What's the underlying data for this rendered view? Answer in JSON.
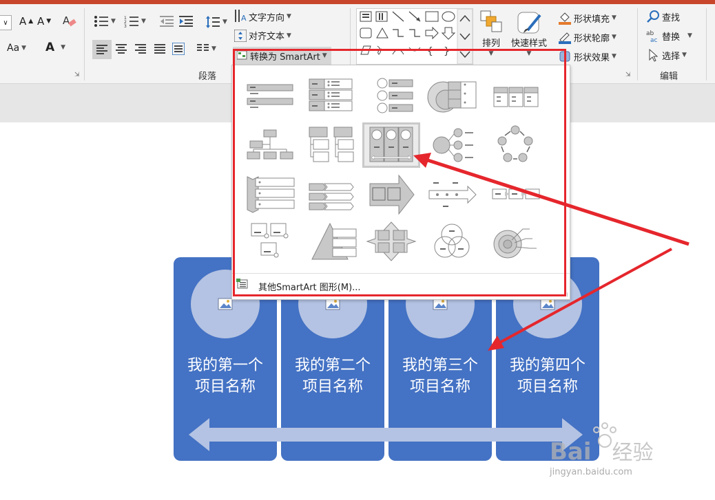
{
  "ribbon": {
    "font": {
      "grow_icon": "font-grow-icon",
      "shrink_icon": "font-shrink-icon",
      "clear_icon": "clear-format-icon",
      "case_label": "Aa",
      "color_label": "A"
    },
    "paragraph": {
      "text_direction": "文字方向",
      "align_text": "对齐文本",
      "convert_smartart": "转换为 SmartArt",
      "group_label": "段落"
    },
    "drawing": {
      "arrange": "排列",
      "quick_styles": "快速样式",
      "shape_fill": "形状填充",
      "shape_outline": "形状轮廓",
      "shape_effects": "形状效果"
    },
    "editing": {
      "find": "查找",
      "replace": "替换",
      "select": "选择",
      "group_label": "编辑"
    }
  },
  "dropdown": {
    "footer": "其他SmartArt 图形(M)...",
    "items": [
      {
        "name": "vertical-bullet-list"
      },
      {
        "name": "vertical-box-list"
      },
      {
        "name": "vertical-circle-list"
      },
      {
        "name": "nested-target-list"
      },
      {
        "name": "horizontal-bullet-list"
      },
      {
        "name": "hierarchy"
      },
      {
        "name": "hierarchy-list"
      },
      {
        "name": "picture-accent-process"
      },
      {
        "name": "radial-list"
      },
      {
        "name": "basic-cycle"
      },
      {
        "name": "chevron-list"
      },
      {
        "name": "arrow-list"
      },
      {
        "name": "up-arrow-process"
      },
      {
        "name": "timeline-arrow"
      },
      {
        "name": "process-arrows"
      },
      {
        "name": "picture-list"
      },
      {
        "name": "pyramid-list"
      },
      {
        "name": "cross-matrix"
      },
      {
        "name": "venn"
      },
      {
        "name": "target"
      }
    ]
  },
  "slide": {
    "items": [
      {
        "line1": "我的第一个",
        "line2": "项目名称"
      },
      {
        "line1": "我的第二个",
        "line2": "项目名称"
      },
      {
        "line1": "我的第三个",
        "line2": "项目名称"
      },
      {
        "line1": "我的第四个",
        "line2": "项目名称"
      }
    ]
  },
  "watermark": {
    "brand": "Bai",
    "brand_cn": "经验",
    "url": "jingyan.baidu.com"
  },
  "colors": {
    "accent_red": "#e5262c",
    "smart_blue": "#4472c4",
    "smart_light": "#b4c3e3",
    "title_bar": "#c8472c"
  }
}
